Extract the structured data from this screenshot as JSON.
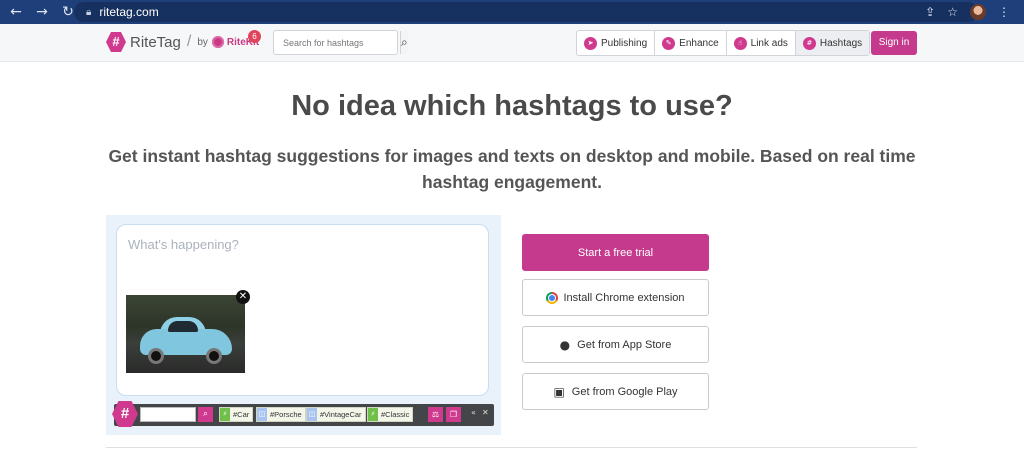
{
  "browser": {
    "url": "ritetag.com",
    "back_icon": "arrow-left-icon",
    "forward_icon": "arrow-right-icon",
    "reload_icon": "reload-icon"
  },
  "header": {
    "logo_text": "RiteTag",
    "logo_symbol": "#",
    "by_text": "by",
    "ritekit_text": "RiteKit",
    "notification_count": "6",
    "search_placeholder": "Search for hashtags",
    "tabs": [
      {
        "label": "Publishing",
        "icon": "paper-plane-icon"
      },
      {
        "label": "Enhance",
        "icon": "wand-icon"
      },
      {
        "label": "Link ads",
        "icon": "pointer-hand-icon"
      },
      {
        "label": "Hashtags",
        "icon": "hashtag-icon"
      }
    ],
    "signin_label": "Sign in"
  },
  "hero": {
    "title": "No idea which hashtags to use?",
    "subtitle": "Get instant hashtag suggestions for images and texts on desktop and mobile. Based on real time hashtag engagement."
  },
  "demo": {
    "placeholder": "What's happening?",
    "bar_symbol": "#",
    "tags": [
      {
        "label": "#Car",
        "color": "green"
      },
      {
        "label": "#Porsche",
        "color": "blue"
      },
      {
        "label": "#VintageCar",
        "color": "blue"
      },
      {
        "label": "#Classic",
        "color": "green"
      }
    ]
  },
  "cta": {
    "trial_label": "Start a free trial",
    "chrome_label": "Install Chrome extension",
    "appstore_label": "Get from App Store",
    "googleplay_label": "Get from Google Play"
  },
  "colors": {
    "brand": "#c63a8e",
    "browser_bar": "#1f3f7a"
  }
}
